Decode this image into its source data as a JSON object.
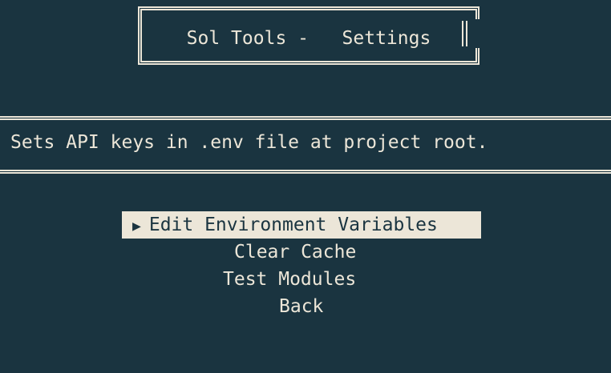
{
  "header": {
    "title": "Sol Tools -   Settings"
  },
  "description": {
    "text": "Sets API keys in .env file at project root."
  },
  "menu": {
    "selected_indicator": "▶",
    "items": [
      {
        "label": "Edit Environment Variables",
        "selected": true
      },
      {
        "label": "Clear Cache",
        "selected": false
      },
      {
        "label": "Test Modules",
        "selected": false
      },
      {
        "label": "Back",
        "selected": false
      }
    ]
  },
  "colors": {
    "background": "#1a3440",
    "foreground": "#ece6d8",
    "highlight_bg": "#ece6d8",
    "highlight_fg": "#1a3440"
  }
}
